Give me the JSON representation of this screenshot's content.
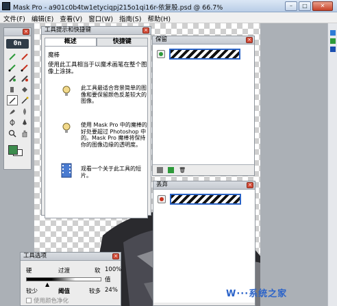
{
  "window": {
    "title": "Mask Pro - a901c0b4tw1etyciqpj215o1qi16r-依复股.psd @ 66.7%",
    "buttons": [
      "–",
      "□",
      "✕"
    ]
  },
  "menu": [
    "文件(F)",
    "编辑(E)",
    "查看(V)",
    "窗口(W)",
    "指南(S)",
    "帮助(H)"
  ],
  "tools_panel": {
    "logo": "0n",
    "tools": [
      "eyedropper-keep-icon",
      "eyedropper-drop-icon",
      "pen-keep-icon",
      "pen-drop-icon",
      "magic-brush-keep-icon",
      "magic-brush-drop-icon",
      "chisel-icon",
      "bucket-icon",
      "magic-pen-icon",
      "magic-wand-icon",
      "brush-icon",
      "blur-icon",
      "eyedropper-icon",
      "dropper-icon",
      "magnifier-icon",
      "hand-icon"
    ],
    "selected_tool": "magic-pen-icon",
    "fg_color": "#3c8c4d",
    "bg_color": "#ffffff"
  },
  "tips_panel": {
    "title": "工具提示和快捷键",
    "tabs": [
      "概述",
      "快捷键"
    ],
    "tool_name": "魔棒",
    "description": "使用此工具相当于以魔术画笔在整个图像上涂抹。",
    "tip1": "此工具最适合背景简单的图像和要保留颜色反差较大的图像。",
    "tip2": "使用 Mask Pro 中的魔棒的好处要超过 Photoshop 中的。Mask Pro 魔棒将保持你的图像边缘的透明度。",
    "tip3": "观看一个关于此工具的短片。"
  },
  "keep_panel": {
    "title": "保留",
    "dot_color": "#2e9a3a"
  },
  "discard_panel": {
    "title": "丢弃",
    "dot_color": "#c8321e"
  },
  "options_panel": {
    "title": "工具选项",
    "hard": "硬",
    "transition": "过渡",
    "soft": "软",
    "soft_pct": "100%",
    "value": "值",
    "less": "较少",
    "threshold": "阈值",
    "more": "较多",
    "more_pct": "24%",
    "purify": "使用颜色净化"
  },
  "watermark": "W···系统之家"
}
